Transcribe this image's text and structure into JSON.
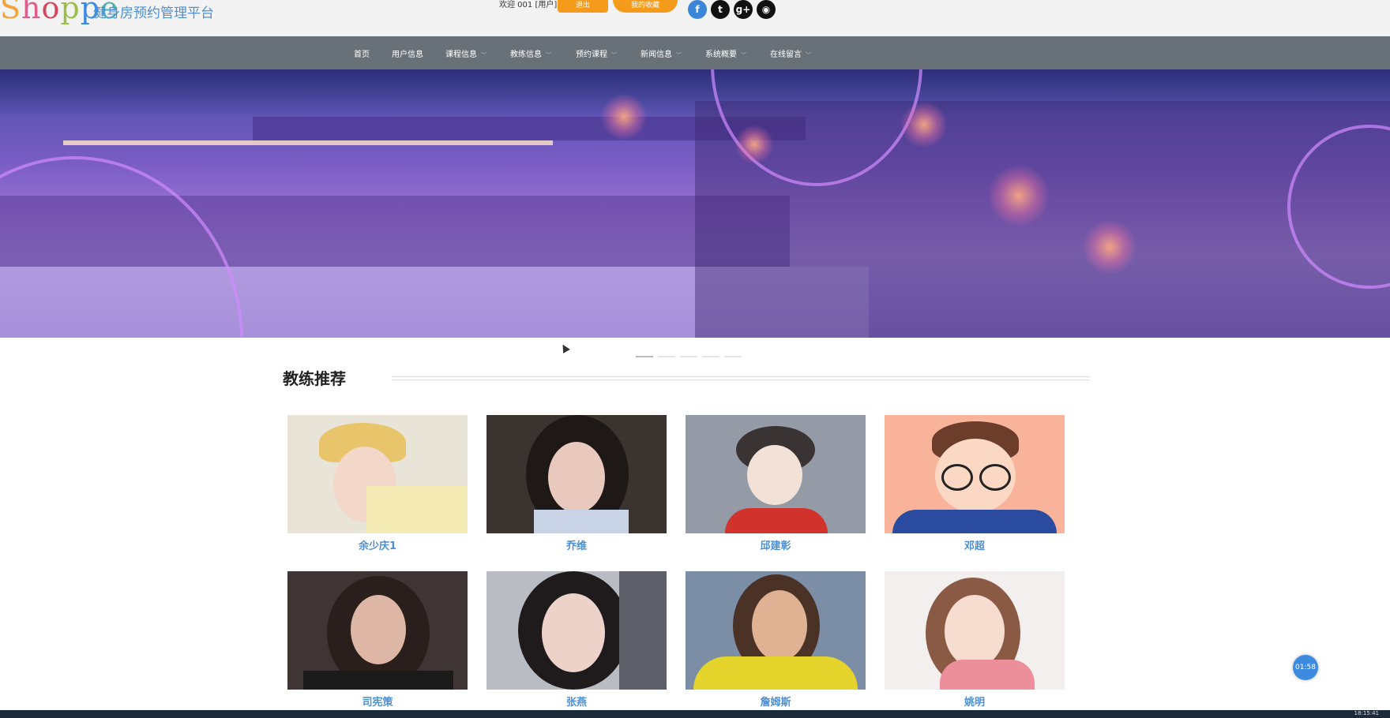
{
  "header": {
    "logo_text": "Shoppe",
    "subtitle": "健身房预约管理平台",
    "welcome": "欢迎 001 [用户]",
    "logout_label": "退出",
    "favorites_label": "我的收藏",
    "social": [
      {
        "icon": "facebook-icon",
        "glyph": "f"
      },
      {
        "icon": "twitter-icon",
        "glyph": "t"
      },
      {
        "icon": "google-plus-icon",
        "glyph": "g+"
      },
      {
        "icon": "rss-icon",
        "glyph": "◉"
      }
    ]
  },
  "nav": {
    "items": [
      {
        "label": "首页",
        "dropdown": false
      },
      {
        "label": "用户信息",
        "dropdown": false
      },
      {
        "label": "课程信息",
        "dropdown": true
      },
      {
        "label": "教练信息",
        "dropdown": true
      },
      {
        "label": "预约课程",
        "dropdown": true
      },
      {
        "label": "新闻信息",
        "dropdown": true
      },
      {
        "label": "系统概要",
        "dropdown": true
      },
      {
        "label": "在线留言",
        "dropdown": true
      }
    ]
  },
  "carousel": {
    "slide_count": 5,
    "active_index": 0
  },
  "coaches": {
    "title": "教练推荐",
    "items": [
      {
        "name": "余少庆1",
        "bg": "#e9e4d8"
      },
      {
        "name": "乔维",
        "bg": "#3a3330"
      },
      {
        "name": "邱建彰",
        "bg": "#949aa6"
      },
      {
        "name": "邓超",
        "bg": "#f9b39a"
      },
      {
        "name": "司宪策",
        "bg": "#3f3535"
      },
      {
        "name": "张燕",
        "bg": "#b9bcc2"
      },
      {
        "name": "詹姆斯",
        "bg": "#7c8da6"
      },
      {
        "name": "姚明",
        "bg": "#f3efee"
      }
    ]
  },
  "timer": {
    "value": "01:58"
  },
  "taskbar": {
    "time": "18:15:41"
  }
}
